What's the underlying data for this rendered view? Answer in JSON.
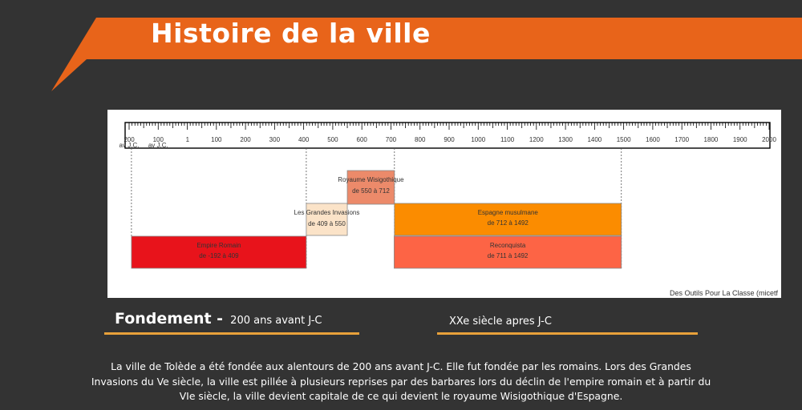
{
  "header": {
    "title": "Histoire de la ville",
    "colors": {
      "banner": "#e8641a",
      "background": "#333333"
    }
  },
  "timeline": {
    "ticks": [
      {
        "line1": "200",
        "line2": "av J.C.",
        "year": -200
      },
      {
        "line1": "100",
        "line2": "av J.C.",
        "year": -100
      },
      {
        "line1": "1",
        "line2": "",
        "year": 1
      },
      {
        "line1": "100",
        "line2": "",
        "year": 100
      },
      {
        "line1": "200",
        "line2": "",
        "year": 200
      },
      {
        "line1": "300",
        "line2": "",
        "year": 300
      },
      {
        "line1": "400",
        "line2": "",
        "year": 400
      },
      {
        "line1": "500",
        "line2": "",
        "year": 500
      },
      {
        "line1": "600",
        "line2": "",
        "year": 600
      },
      {
        "line1": "700",
        "line2": "",
        "year": 700
      },
      {
        "line1": "800",
        "line2": "",
        "year": 800
      },
      {
        "line1": "900",
        "line2": "",
        "year": 900
      },
      {
        "line1": "1000",
        "line2": "",
        "year": 1000
      },
      {
        "line1": "1100",
        "line2": "",
        "year": 1100
      },
      {
        "line1": "1200",
        "line2": "",
        "year": 1200
      },
      {
        "line1": "1300",
        "line2": "",
        "year": 1300
      },
      {
        "line1": "1400",
        "line2": "",
        "year": 1400
      },
      {
        "line1": "1500",
        "line2": "",
        "year": 1500
      },
      {
        "line1": "1600",
        "line2": "",
        "year": 1600
      },
      {
        "line1": "1700",
        "line2": "",
        "year": 1700
      },
      {
        "line1": "1800",
        "line2": "",
        "year": 1800
      },
      {
        "line1": "1900",
        "line2": "",
        "year": 1900
      },
      {
        "line1": "2000",
        "line2": "",
        "year": 2000
      }
    ],
    "periods": [
      {
        "name": "Empire Romain",
        "range": "de -192 à 409",
        "start": -192,
        "end": 409,
        "row": 3,
        "color": "#e8131b",
        "label_inside": true
      },
      {
        "name": "Les Grandes Invasions",
        "range": "de 409 à 550",
        "start": 409,
        "end": 550,
        "row": 2,
        "color": "#fbe3c8",
        "label_inside": false
      },
      {
        "name": "Royaume Wisigothique",
        "range": "de 550 à 712",
        "start": 550,
        "end": 712,
        "row": 1,
        "color": "#ec8a6a",
        "label_inside": false
      },
      {
        "name": "Espagne musulmane",
        "range": "de 712 à 1492",
        "start": 712,
        "end": 1492,
        "row": 2,
        "color": "#fb8c00",
        "label_inside": true
      },
      {
        "name": "Reconquista",
        "range": "de 711 à 1492",
        "start": 711,
        "end": 1492,
        "row": 3,
        "color": "#fd6445",
        "label_inside": true
      }
    ],
    "credit": "Des Outils Pour La Classe (micetf"
  },
  "sections": {
    "left_heading": "Fondement -",
    "left_sub": "200 ans avant J-C",
    "right_heading": "XXe siècle apres J-C"
  },
  "paragraph": "La ville de Tolède a été fondée aux alentours de 200 ans avant J-C. Elle fut fondée par les romains. Lors des Grandes Invasions du Ve siècle, la ville est pillée à plusieurs reprises par des barbares lors du déclin de l'empire romain et à partir du VIe siècle, la ville devient capitale de ce qui devient le royaume Wisigothique d'Espagne."
}
